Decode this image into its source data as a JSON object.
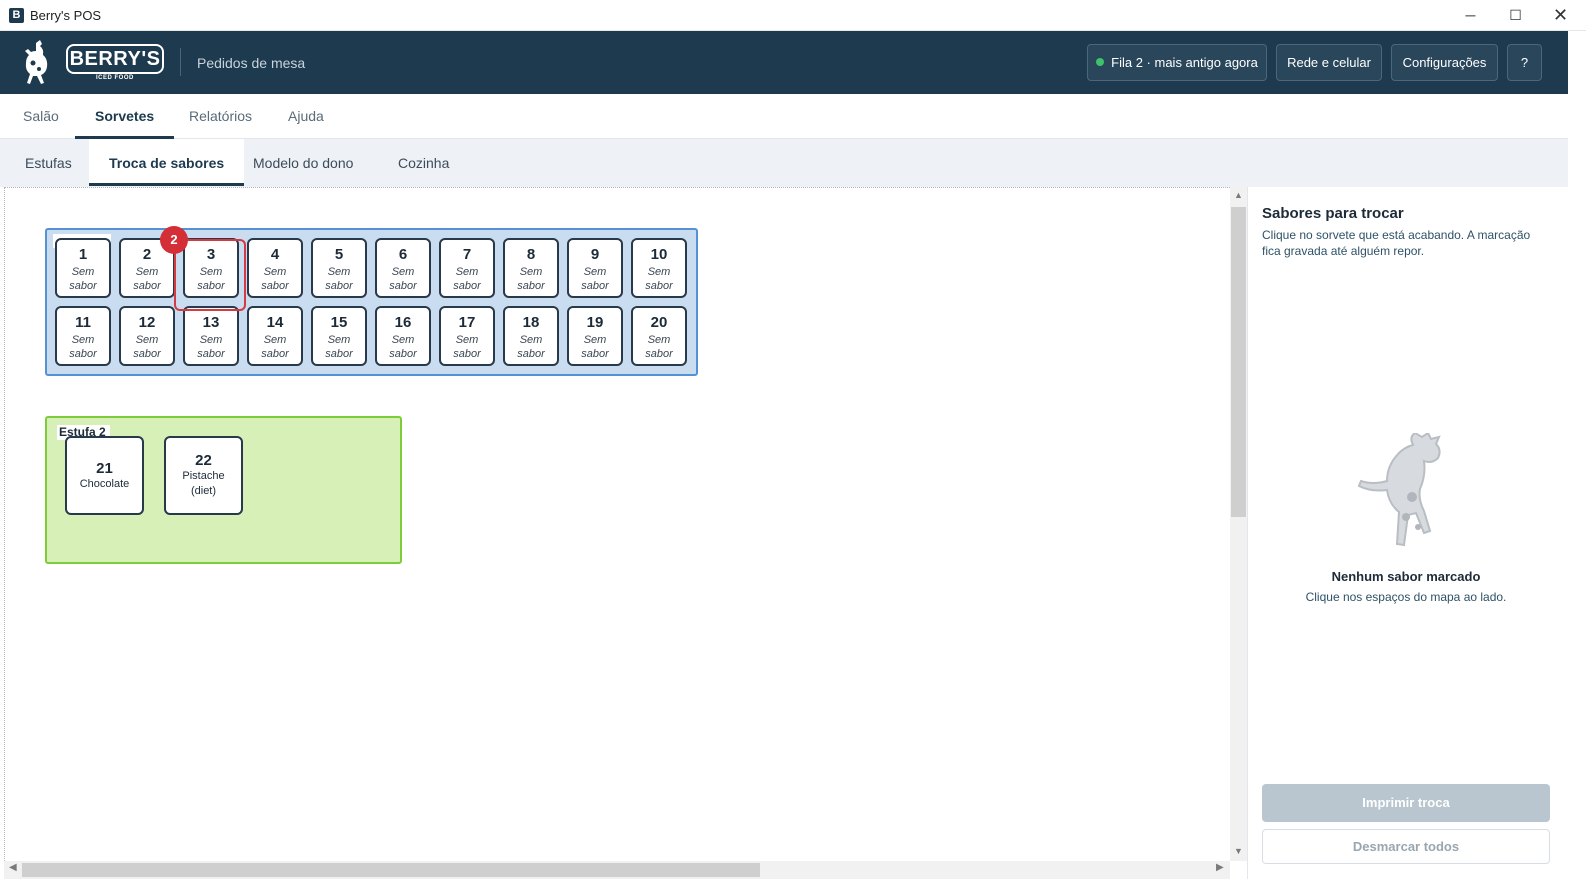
{
  "window": {
    "title": "Berry's POS",
    "icon": "app-icon",
    "controls": {
      "minimize": "─",
      "maximize": "☐",
      "close": "✕"
    }
  },
  "header": {
    "logo": {
      "brand": "BERRY'S",
      "tagline": "ICED FOOD"
    },
    "subtitle": "Pedidos de mesa",
    "queue_label": "Fila 2 · mais antigo agora",
    "queue_status_color": "#3ec26a",
    "network_label": "Rede e celular",
    "settings_label": "Configurações",
    "help_label": "?"
  },
  "primary_tabs": [
    {
      "label": "Salão",
      "active": false
    },
    {
      "label": "Sorvetes",
      "active": true
    },
    {
      "label": "Relatórios",
      "active": false
    },
    {
      "label": "Ajuda",
      "active": false
    }
  ],
  "secondary_tabs": [
    {
      "label": "Estufas",
      "active": false
    },
    {
      "label": "Troca de sabores",
      "active": true
    },
    {
      "label": "Modelo do dono",
      "active": false
    },
    {
      "label": "Cozinha",
      "active": false
    }
  ],
  "estufa1": {
    "color": "#c9dcf0",
    "slots": [
      {
        "num": "1",
        "flavor": "Sem sabor"
      },
      {
        "num": "2",
        "flavor": "Sem sabor"
      },
      {
        "num": "3",
        "flavor": "Sem sabor"
      },
      {
        "num": "4",
        "flavor": "Sem sabor"
      },
      {
        "num": "5",
        "flavor": "Sem sabor"
      },
      {
        "num": "6",
        "flavor": "Sem sabor"
      },
      {
        "num": "7",
        "flavor": "Sem sabor"
      },
      {
        "num": "8",
        "flavor": "Sem sabor"
      },
      {
        "num": "9",
        "flavor": "Sem sabor"
      },
      {
        "num": "10",
        "flavor": "Sem sabor"
      },
      {
        "num": "11",
        "flavor": "Sem sabor"
      },
      {
        "num": "12",
        "flavor": "Sem sabor"
      },
      {
        "num": "13",
        "flavor": "Sem sabor"
      },
      {
        "num": "14",
        "flavor": "Sem sabor"
      },
      {
        "num": "15",
        "flavor": "Sem sabor"
      },
      {
        "num": "16",
        "flavor": "Sem sabor"
      },
      {
        "num": "17",
        "flavor": "Sem sabor"
      },
      {
        "num": "18",
        "flavor": "Sem sabor"
      },
      {
        "num": "19",
        "flavor": "Sem sabor"
      },
      {
        "num": "20",
        "flavor": "Sem sabor"
      }
    ],
    "marker_badge": "2"
  },
  "estufa2": {
    "label": "Estufa 2",
    "color": "#d6f0b8",
    "slots": [
      {
        "num": "21",
        "flavor": "Chocolate"
      },
      {
        "num": "22",
        "flavor": "Pistache (diet)"
      }
    ]
  },
  "side_panel": {
    "title": "Sabores para trocar",
    "description": "Clique no sorvete que está acabando. A marcação fica gravada até alguém repor.",
    "empty_title": "Nenhum sabor marcado",
    "empty_subtitle": "Clique nos espaços do mapa ao lado.",
    "print_button": "Imprimir troca",
    "clear_button": "Desmarcar todos"
  }
}
